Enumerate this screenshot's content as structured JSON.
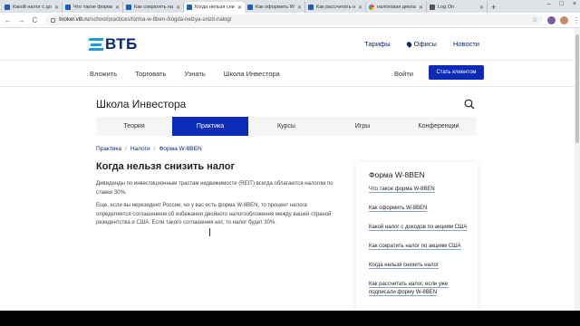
{
  "browser": {
    "tabs": [
      {
        "title": "Какой налог с дох",
        "favicon": "vtb",
        "active": false
      },
      {
        "title": "Что такое форма",
        "favicon": "vtb",
        "active": false
      },
      {
        "title": "Как сократить на",
        "favicon": "vtb",
        "active": false
      },
      {
        "title": "Когда нельзя сни",
        "favicon": "vtb",
        "active": true
      },
      {
        "title": "Как оформить W",
        "favicon": "vtb",
        "active": false
      },
      {
        "title": "Как рассчитать н",
        "favicon": "vtb",
        "active": false
      },
      {
        "title": "налоговая деклар",
        "favicon": "google",
        "active": false
      },
      {
        "title": "Log On",
        "favicon": "log",
        "active": false
      }
    ],
    "new_tab": "+",
    "window_controls": [
      "–",
      "□",
      "×"
    ],
    "url_host": "broker.vtb.ru",
    "url_path": "/school/practices/forma-w-8ben-/kogda-nelzya-snizit-nalog/",
    "nav": {
      "back": "←",
      "forward": "→",
      "reload": "C"
    }
  },
  "site": {
    "logo_text": "ВТБ",
    "brand_color": "#0a2cb8",
    "top_links": {
      "tariffs": "Тарифы",
      "offices": "Офисы",
      "news": "Новости"
    },
    "main_nav": [
      "Вложить",
      "Торговать",
      "Узнать",
      "Школа Инвестора"
    ],
    "login": "Войти",
    "become_client": "Стать клиентом"
  },
  "school": {
    "title": "Школа Инвестора",
    "tabs": [
      {
        "label": "Теория",
        "active": false
      },
      {
        "label": "Практика",
        "active": true
      },
      {
        "label": "Курсы",
        "active": false
      },
      {
        "label": "Игры",
        "active": false
      },
      {
        "label": "Конференции",
        "active": false
      }
    ]
  },
  "breadcrumb": [
    "Практика",
    "Налоги",
    "Форма W-8BEN"
  ],
  "article": {
    "title": "Когда нельзя снизить налог",
    "p1": "Дивиденды по инвестиционным трастам недвижимости (REIT) всегда облагаются налогом по ставке 30%.",
    "p2": "Еще, если вы нерезидент России, но у вас есть форма W-8BEN, то процент налога определяется соглашением об избежании двойного налогообложения между вашей страной резидентства и США. Если такого соглашения нет, то налог будет 30%."
  },
  "sidebar": {
    "heading": "Форма W-8BEN",
    "links": [
      "Что такое форма W-8BEN",
      "Как оформить W-8BEN",
      "Какой налог с доходов по акциям США",
      "Как сократить налог по акциям США",
      "Когда нельзя снизить налог",
      "Как рассчитать налог, если уже подписали форму W-8BEN"
    ]
  }
}
